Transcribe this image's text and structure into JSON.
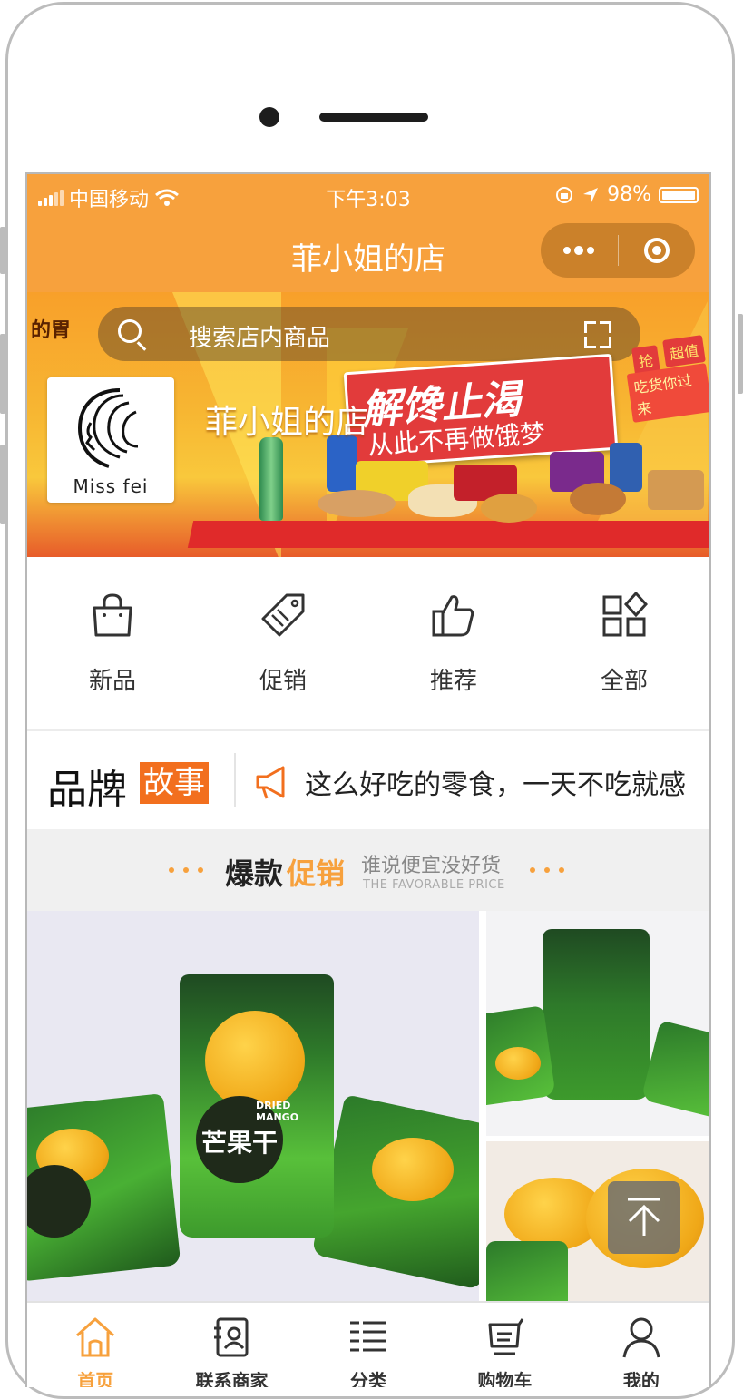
{
  "status_bar": {
    "carrier": "中国移动",
    "time": "下午3:03",
    "battery": "98%"
  },
  "nav": {
    "title": "菲小姐的店"
  },
  "banner": {
    "search_placeholder": "搜索店内商品",
    "logo_text": "Miss fei",
    "shop_name": "菲小姐的店",
    "slogan_main": "解馋止渴",
    "slogan_sub": "从此不再做饿梦",
    "corner_text": "的胃",
    "tag_grab": "抢",
    "tag_value": "超值",
    "tag_eat": "吃货你过来"
  },
  "quick_nav": [
    {
      "label": "新品",
      "icon": "shopping-bag-icon"
    },
    {
      "label": "促销",
      "icon": "price-tag-icon"
    },
    {
      "label": "推荐",
      "icon": "thumbs-up-icon"
    },
    {
      "label": "全部",
      "icon": "grid-icon"
    }
  ],
  "notice": {
    "brand": "品牌",
    "story": "故事",
    "text": "这么好吃的零食，一天不吃就感"
  },
  "section": {
    "title_a": "爆款",
    "title_b": "促销",
    "subtitle": "谁说便宜没好货",
    "subtitle_en": "THE FAVORABLE PRICE"
  },
  "products": {
    "main_label": "芒果干",
    "main_label_en": "DRIED MANGO"
  },
  "tabbar": [
    {
      "label": "首页",
      "icon": "home-icon",
      "active": true
    },
    {
      "label": "联系商家",
      "icon": "contact-card-icon",
      "active": false
    },
    {
      "label": "分类",
      "icon": "category-list-icon",
      "active": false
    },
    {
      "label": "购物车",
      "icon": "cart-icon",
      "active": false
    },
    {
      "label": "我的",
      "icon": "user-icon",
      "active": false
    }
  ],
  "colors": {
    "primary": "#f7a13d",
    "accent": "#f26f1e",
    "promo_red": "#e23b3b"
  }
}
